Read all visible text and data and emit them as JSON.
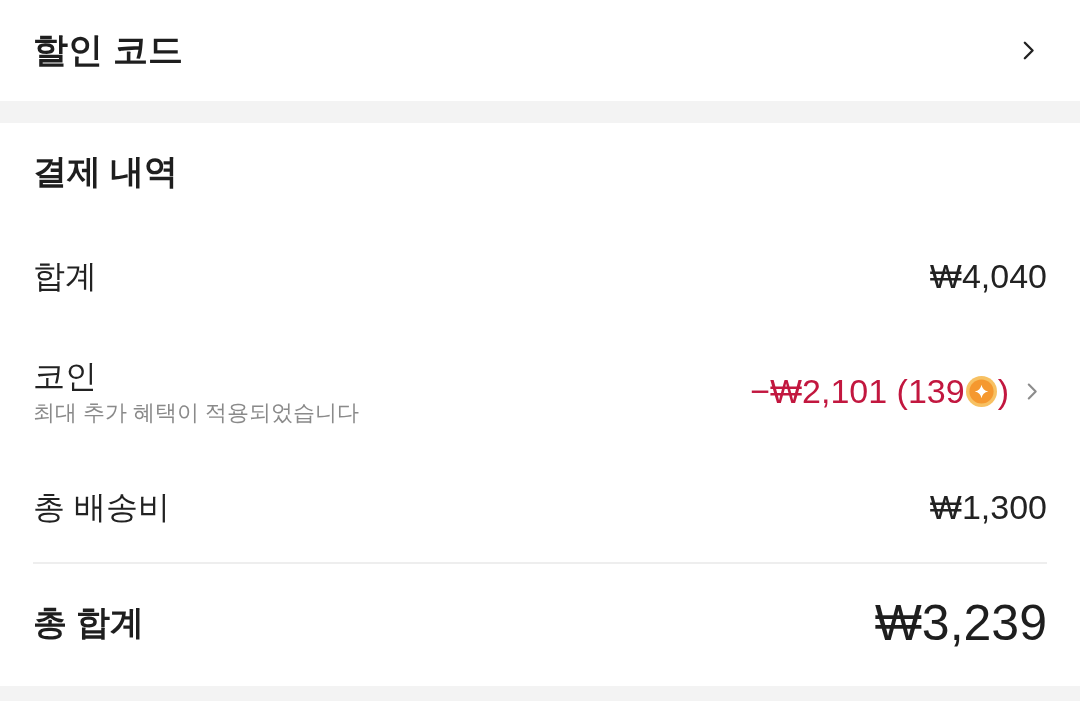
{
  "discount_code": {
    "label": "할인 코드"
  },
  "payment_details": {
    "title": "결제 내역",
    "rows": [
      {
        "kind": "plain",
        "label": "합계",
        "value": "₩4,040"
      },
      {
        "kind": "coin",
        "label": "코인",
        "subtitle": "최대 추가 혜택이 적용되었습니다",
        "value": "−₩2,101 (139",
        "value_close": ")"
      },
      {
        "kind": "plain",
        "label": "총 배송비",
        "value": "₩1,300"
      }
    ],
    "total": {
      "label": "총 합계",
      "value": "₩3,239"
    }
  }
}
